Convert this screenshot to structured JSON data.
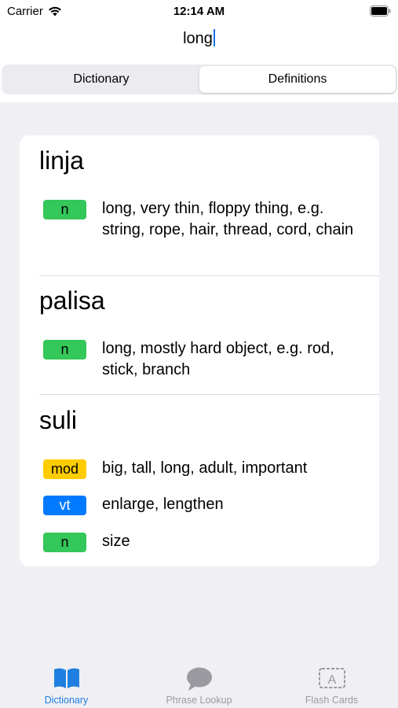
{
  "status_bar": {
    "carrier": "Carrier",
    "time": "12:14 AM"
  },
  "search": {
    "query": "long"
  },
  "segmented": {
    "items": [
      {
        "label": "Dictionary",
        "active": false
      },
      {
        "label": "Definitions",
        "active": true
      }
    ]
  },
  "entries": [
    {
      "word": "linja",
      "definitions": [
        {
          "pos": "n",
          "pos_color": "#34c759",
          "text": "long, very thin, floppy thing, e.g. string, rope, hair, thread, cord, chain"
        }
      ]
    },
    {
      "word": "palisa",
      "definitions": [
        {
          "pos": "n",
          "pos_color": "#34c759",
          "text": "long, mostly hard object, e.g. rod, stick, branch"
        }
      ]
    },
    {
      "word": "suli",
      "definitions": [
        {
          "pos": "mod",
          "pos_color": "#ffcc00",
          "text": "big, tall, long, adult, important"
        },
        {
          "pos": "vt",
          "pos_color": "#007aff",
          "text": "enlarge, lengthen"
        },
        {
          "pos": "n",
          "pos_color": "#34c759",
          "text": "size"
        }
      ]
    }
  ],
  "tab_bar": {
    "tabs": [
      {
        "label": "Dictionary",
        "icon": "book-icon",
        "active": true
      },
      {
        "label": "Phrase Lookup",
        "icon": "speech-bubble-icon",
        "active": false
      },
      {
        "label": "Flash Cards",
        "icon": "flash-card-icon",
        "active": false
      }
    ],
    "active_color": "#1e7fe0",
    "inactive_color": "#9a9aa0"
  }
}
